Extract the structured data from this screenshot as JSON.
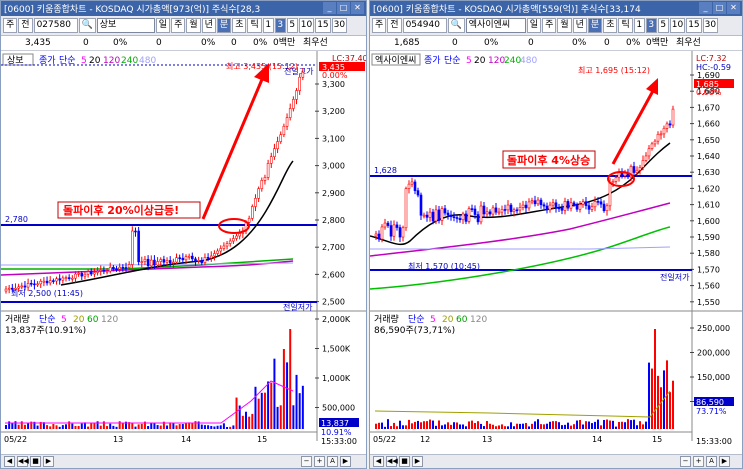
{
  "left": {
    "title": "[0600] 키움종합차트 - KOSDAQ 시가총액[973(억)]  주식수[28,3",
    "code": "027580",
    "name": "상보",
    "jeon": "전",
    "ju": "주",
    "periods": [
      "일",
      "주",
      "월",
      "년",
      "분",
      "초",
      "틱"
    ],
    "active_period": "분",
    "intervals": [
      "1",
      "3",
      "5",
      "10",
      "15",
      "30"
    ],
    "active_interval": "3",
    "info": {
      "price": "3,435",
      "v1": "0",
      "v2": "0%",
      "v3": "0",
      "v4": "0%",
      "v5": "0",
      "v6": "0%",
      "v7": "0백만",
      "v8": "최우선"
    },
    "legend": {
      "name": "상보",
      "price_label": "종가",
      "type": "단순",
      "ma": [
        "5",
        "20",
        "120",
        "240",
        "480"
      ]
    },
    "high_label": "최고 3,435 (15:12)",
    "prev_high_label": "전일고가",
    "low_label": "최저 2,500 (11:45)",
    "prev_low_label": "전일저가",
    "level_label": "2,780",
    "annotation": "돌파이후  20%이상급등!",
    "price_box": {
      "top": "LC:37.40",
      "price": "3,435",
      "pct": "0.00%"
    },
    "yticks": [
      "3,300",
      "3,200",
      "3,100",
      "3,000",
      "2,900",
      "2,800",
      "2,700",
      "2,600",
      "2,500"
    ],
    "vol_legend": {
      "name": "거래량",
      "type": "단순",
      "ma": [
        "5",
        "20",
        "60",
        "120"
      ]
    },
    "vol_value": "13,837주(10.91%)",
    "vol_yticks": [
      "2,000K",
      "1,500K",
      "1,000K",
      "500,000"
    ],
    "vol_box": {
      "value": "13,837",
      "pct": "10.91%"
    },
    "xlabels": [
      "05/22",
      "13",
      "14",
      "15"
    ],
    "time": "15:33:00"
  },
  "right": {
    "title": "[0600] 키움종합차트 - KOSDAQ 시가총액[559(억)]  주식수[33,174",
    "code": "054940",
    "name": "엑사이엔씨",
    "jeon": "전",
    "ju": "주",
    "periods": [
      "일",
      "주",
      "월",
      "년",
      "분",
      "초",
      "틱"
    ],
    "active_period": "분",
    "intervals": [
      "1",
      "3",
      "5",
      "10",
      "15",
      "30"
    ],
    "active_interval": "3",
    "info": {
      "price": "1,685",
      "v1": "0",
      "v2": "0%",
      "v3": "0",
      "v4": "0%",
      "v5": "0",
      "v6": "0%",
      "v7": "0백만",
      "v8": "최우선"
    },
    "legend": {
      "name": "엑사이엔씨",
      "price_label": "종가",
      "type": "단순",
      "ma": [
        "5",
        "20",
        "120",
        "240",
        "480"
      ]
    },
    "high_label": "최고 1,695 (15:12)",
    "low_label": "최저 1,570 (10:45)",
    "prev_low_label": "전일저가",
    "level_label": "1,628",
    "annotation": "돌파이후  4%상승",
    "price_box": {
      "top": "LC:7.32",
      "sub": "HC:-0.59",
      "price": "1,685",
      "pct": "0.00%"
    },
    "yticks": [
      "1,690",
      "1,680",
      "1,670",
      "1,660",
      "1,650",
      "1,640",
      "1,630",
      "1,620",
      "1,610",
      "1,600",
      "1,590",
      "1,580",
      "1,570",
      "1,560",
      "1,550"
    ],
    "vol_legend": {
      "name": "거래량",
      "type": "단순",
      "ma": [
        "5",
        "20",
        "60",
        "120"
      ]
    },
    "vol_value": "86,590주(73,71%)",
    "vol_yticks": [
      "250,000",
      "200,000",
      "150,000",
      "100,000"
    ],
    "vol_box": {
      "value": "86,590",
      "pct": "73.71%"
    },
    "xlabels": [
      "05/22",
      "12",
      "13",
      "14",
      "15"
    ],
    "time": "15:33:00"
  },
  "colors": {
    "up": "#ff0000",
    "down": "#0000ff",
    "ma5": "#ff00ff",
    "ma20": "#00a000",
    "ma120": "#c000c0",
    "ma240": "#00c000",
    "ma480": "#000000",
    "annotation": "#ff0000",
    "level": "#0000c8",
    "title_bg": "#3c64a8"
  }
}
